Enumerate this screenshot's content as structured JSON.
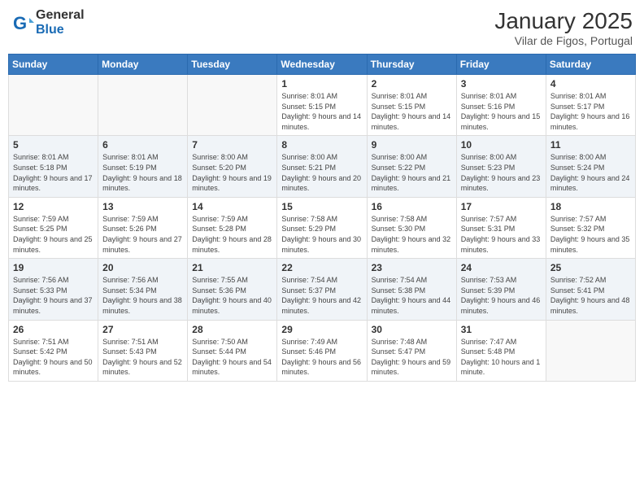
{
  "logo": {
    "general": "General",
    "blue": "Blue"
  },
  "header": {
    "month": "January 2025",
    "location": "Vilar de Figos, Portugal"
  },
  "weekdays": [
    "Sunday",
    "Monday",
    "Tuesday",
    "Wednesday",
    "Thursday",
    "Friday",
    "Saturday"
  ],
  "weeks": [
    [
      {
        "day": "",
        "info": ""
      },
      {
        "day": "",
        "info": ""
      },
      {
        "day": "",
        "info": ""
      },
      {
        "day": "1",
        "info": "Sunrise: 8:01 AM\nSunset: 5:15 PM\nDaylight: 9 hours\nand 14 minutes."
      },
      {
        "day": "2",
        "info": "Sunrise: 8:01 AM\nSunset: 5:15 PM\nDaylight: 9 hours\nand 14 minutes."
      },
      {
        "day": "3",
        "info": "Sunrise: 8:01 AM\nSunset: 5:16 PM\nDaylight: 9 hours\nand 15 minutes."
      },
      {
        "day": "4",
        "info": "Sunrise: 8:01 AM\nSunset: 5:17 PM\nDaylight: 9 hours\nand 16 minutes."
      }
    ],
    [
      {
        "day": "5",
        "info": "Sunrise: 8:01 AM\nSunset: 5:18 PM\nDaylight: 9 hours\nand 17 minutes."
      },
      {
        "day": "6",
        "info": "Sunrise: 8:01 AM\nSunset: 5:19 PM\nDaylight: 9 hours\nand 18 minutes."
      },
      {
        "day": "7",
        "info": "Sunrise: 8:00 AM\nSunset: 5:20 PM\nDaylight: 9 hours\nand 19 minutes."
      },
      {
        "day": "8",
        "info": "Sunrise: 8:00 AM\nSunset: 5:21 PM\nDaylight: 9 hours\nand 20 minutes."
      },
      {
        "day": "9",
        "info": "Sunrise: 8:00 AM\nSunset: 5:22 PM\nDaylight: 9 hours\nand 21 minutes."
      },
      {
        "day": "10",
        "info": "Sunrise: 8:00 AM\nSunset: 5:23 PM\nDaylight: 9 hours\nand 23 minutes."
      },
      {
        "day": "11",
        "info": "Sunrise: 8:00 AM\nSunset: 5:24 PM\nDaylight: 9 hours\nand 24 minutes."
      }
    ],
    [
      {
        "day": "12",
        "info": "Sunrise: 7:59 AM\nSunset: 5:25 PM\nDaylight: 9 hours\nand 25 minutes."
      },
      {
        "day": "13",
        "info": "Sunrise: 7:59 AM\nSunset: 5:26 PM\nDaylight: 9 hours\nand 27 minutes."
      },
      {
        "day": "14",
        "info": "Sunrise: 7:59 AM\nSunset: 5:28 PM\nDaylight: 9 hours\nand 28 minutes."
      },
      {
        "day": "15",
        "info": "Sunrise: 7:58 AM\nSunset: 5:29 PM\nDaylight: 9 hours\nand 30 minutes."
      },
      {
        "day": "16",
        "info": "Sunrise: 7:58 AM\nSunset: 5:30 PM\nDaylight: 9 hours\nand 32 minutes."
      },
      {
        "day": "17",
        "info": "Sunrise: 7:57 AM\nSunset: 5:31 PM\nDaylight: 9 hours\nand 33 minutes."
      },
      {
        "day": "18",
        "info": "Sunrise: 7:57 AM\nSunset: 5:32 PM\nDaylight: 9 hours\nand 35 minutes."
      }
    ],
    [
      {
        "day": "19",
        "info": "Sunrise: 7:56 AM\nSunset: 5:33 PM\nDaylight: 9 hours\nand 37 minutes."
      },
      {
        "day": "20",
        "info": "Sunrise: 7:56 AM\nSunset: 5:34 PM\nDaylight: 9 hours\nand 38 minutes."
      },
      {
        "day": "21",
        "info": "Sunrise: 7:55 AM\nSunset: 5:36 PM\nDaylight: 9 hours\nand 40 minutes."
      },
      {
        "day": "22",
        "info": "Sunrise: 7:54 AM\nSunset: 5:37 PM\nDaylight: 9 hours\nand 42 minutes."
      },
      {
        "day": "23",
        "info": "Sunrise: 7:54 AM\nSunset: 5:38 PM\nDaylight: 9 hours\nand 44 minutes."
      },
      {
        "day": "24",
        "info": "Sunrise: 7:53 AM\nSunset: 5:39 PM\nDaylight: 9 hours\nand 46 minutes."
      },
      {
        "day": "25",
        "info": "Sunrise: 7:52 AM\nSunset: 5:41 PM\nDaylight: 9 hours\nand 48 minutes."
      }
    ],
    [
      {
        "day": "26",
        "info": "Sunrise: 7:51 AM\nSunset: 5:42 PM\nDaylight: 9 hours\nand 50 minutes."
      },
      {
        "day": "27",
        "info": "Sunrise: 7:51 AM\nSunset: 5:43 PM\nDaylight: 9 hours\nand 52 minutes."
      },
      {
        "day": "28",
        "info": "Sunrise: 7:50 AM\nSunset: 5:44 PM\nDaylight: 9 hours\nand 54 minutes."
      },
      {
        "day": "29",
        "info": "Sunrise: 7:49 AM\nSunset: 5:46 PM\nDaylight: 9 hours\nand 56 minutes."
      },
      {
        "day": "30",
        "info": "Sunrise: 7:48 AM\nSunset: 5:47 PM\nDaylight: 9 hours\nand 59 minutes."
      },
      {
        "day": "31",
        "info": "Sunrise: 7:47 AM\nSunset: 5:48 PM\nDaylight: 10 hours\nand 1 minute."
      },
      {
        "day": "",
        "info": ""
      }
    ]
  ]
}
